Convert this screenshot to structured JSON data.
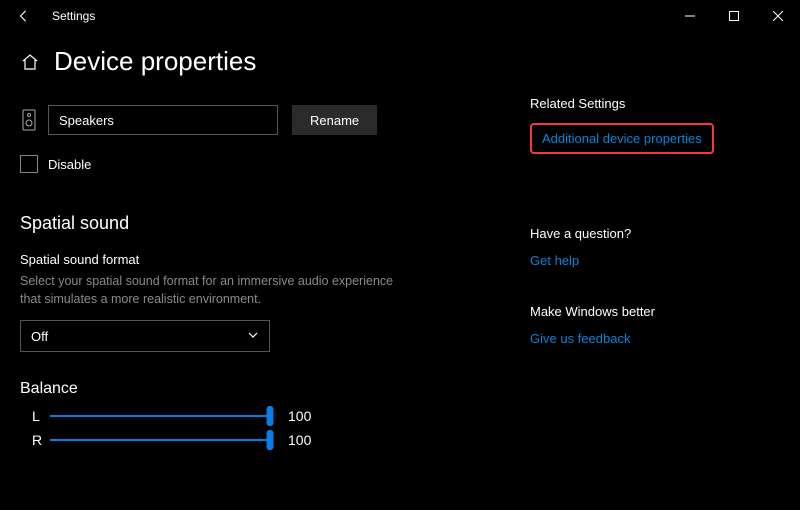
{
  "window": {
    "title": "Settings"
  },
  "page": {
    "heading": "Device properties"
  },
  "device": {
    "name_value": "Speakers",
    "rename_label": "Rename",
    "disable_label": "Disable",
    "disabled": false
  },
  "spatial": {
    "heading": "Spatial sound",
    "format_label": "Spatial sound format",
    "help_text": "Select your spatial sound format for an immersive audio experience that simulates a more realistic environment.",
    "selected": "Off"
  },
  "balance": {
    "heading": "Balance",
    "left_label": "L",
    "right_label": "R",
    "left_value": 100,
    "right_value": 100
  },
  "sidebar": {
    "related_heading": "Related Settings",
    "additional_props": "Additional device properties",
    "question_heading": "Have a question?",
    "get_help": "Get help",
    "better_heading": "Make Windows better",
    "feedback": "Give us feedback"
  }
}
